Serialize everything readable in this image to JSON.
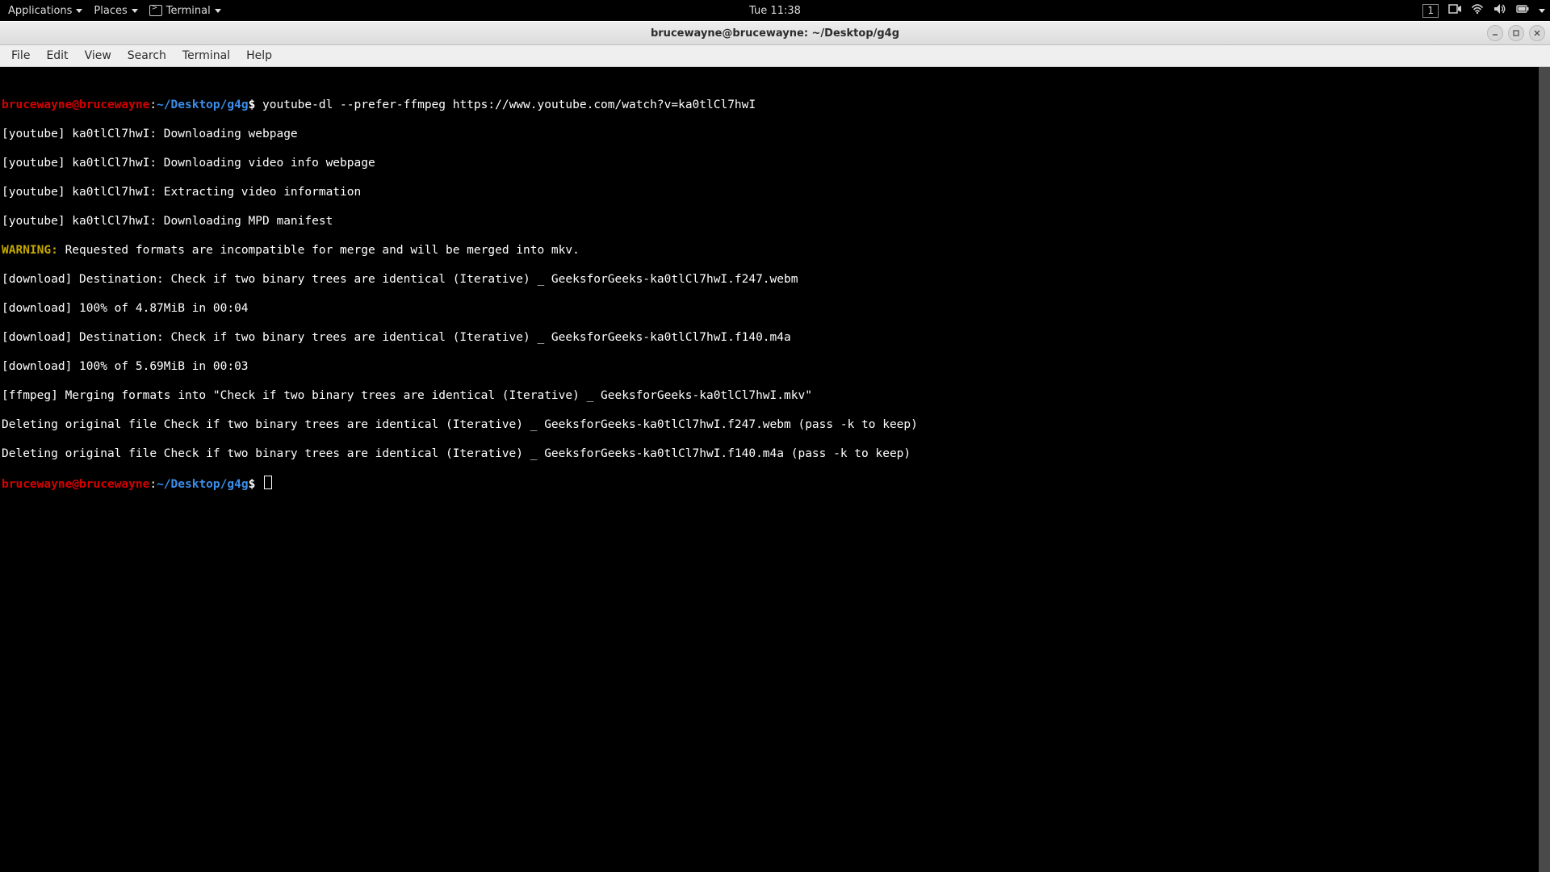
{
  "panel": {
    "applications": "Applications",
    "places": "Places",
    "terminal": "Terminal",
    "clock": "Tue 11:38",
    "badge": "1"
  },
  "window": {
    "title": "brucewayne@brucewayne: ~/Desktop/g4g"
  },
  "menubar": {
    "items": [
      "File",
      "Edit",
      "View",
      "Search",
      "Terminal",
      "Help"
    ]
  },
  "prompt": {
    "user_host": "brucewayne@brucewayne",
    "colon": ":",
    "path": "~/Desktop/g4g",
    "dollar": "$"
  },
  "terminal": {
    "command": "youtube-dl --prefer-ffmpeg https://www.youtube.com/watch?v=ka0tlCl7hwI",
    "lines": [
      "[youtube] ka0tlCl7hwI: Downloading webpage",
      "[youtube] ka0tlCl7hwI: Downloading video info webpage",
      "[youtube] ka0tlCl7hwI: Extracting video information",
      "[youtube] ka0tlCl7hwI: Downloading MPD manifest"
    ],
    "warning_label": "WARNING:",
    "warning_text": " Requested formats are incompatible for merge and will be merged into mkv.",
    "after_warning": [
      "[download] Destination: Check if two binary trees are identical (Iterative) _ GeeksforGeeks-ka0tlCl7hwI.f247.webm",
      "[download] 100% of 4.87MiB in 00:04",
      "[download] Destination: Check if two binary trees are identical (Iterative) _ GeeksforGeeks-ka0tlCl7hwI.f140.m4a",
      "[download] 100% of 5.69MiB in 00:03",
      "[ffmpeg] Merging formats into \"Check if two binary trees are identical (Iterative) _ GeeksforGeeks-ka0tlCl7hwI.mkv\"",
      "Deleting original file Check if two binary trees are identical (Iterative) _ GeeksforGeeks-ka0tlCl7hwI.f247.webm (pass -k to keep)",
      "Deleting original file Check if two binary trees are identical (Iterative) _ GeeksforGeeks-ka0tlCl7hwI.f140.m4a (pass -k to keep)"
    ]
  }
}
